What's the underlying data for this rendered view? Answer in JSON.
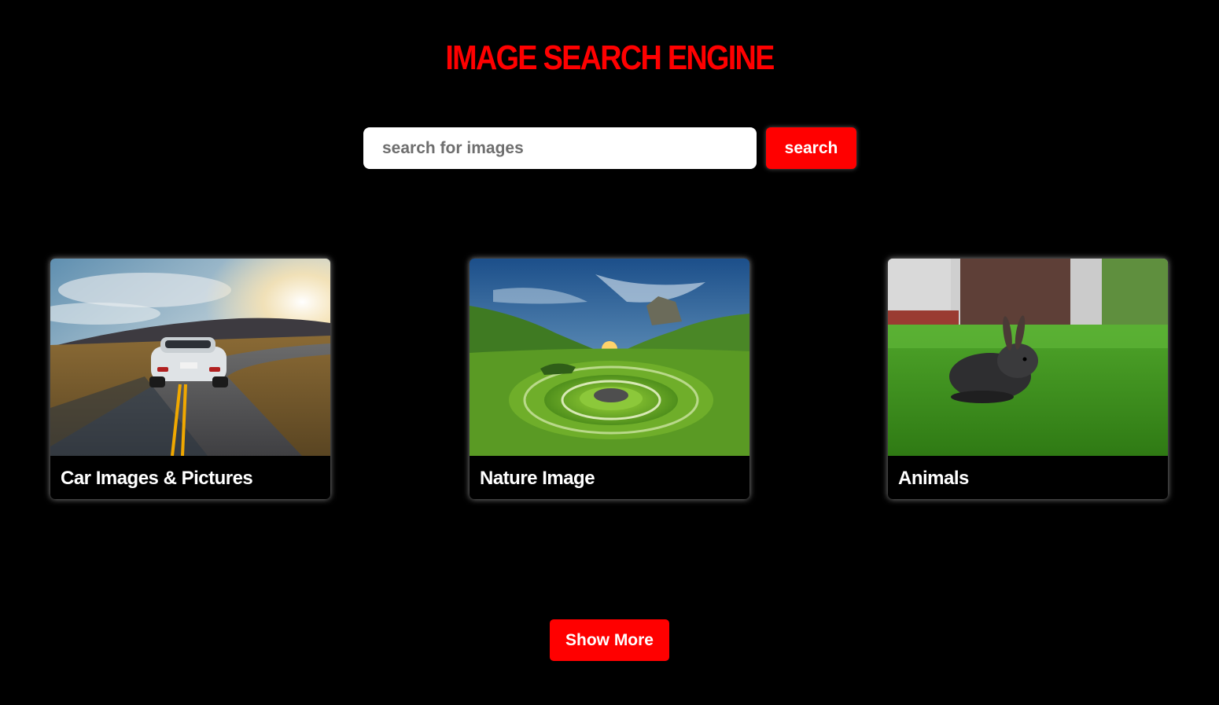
{
  "header": {
    "title": "IMAGE SEARCH ENGINE"
  },
  "search": {
    "placeholder": "search for images",
    "value": "",
    "button_label": "search"
  },
  "results": [
    {
      "caption": "Car Images & Pictures",
      "image": "car-on-road-photo"
    },
    {
      "caption": "Nature Image",
      "image": "green-valley-stone-circles-photo"
    },
    {
      "caption": "Animals",
      "image": "rabbit-on-grass-photo"
    }
  ],
  "footer": {
    "show_more_label": "Show More"
  },
  "colors": {
    "background": "#000000",
    "accent": "#ff0000",
    "text": "#ffffff"
  }
}
